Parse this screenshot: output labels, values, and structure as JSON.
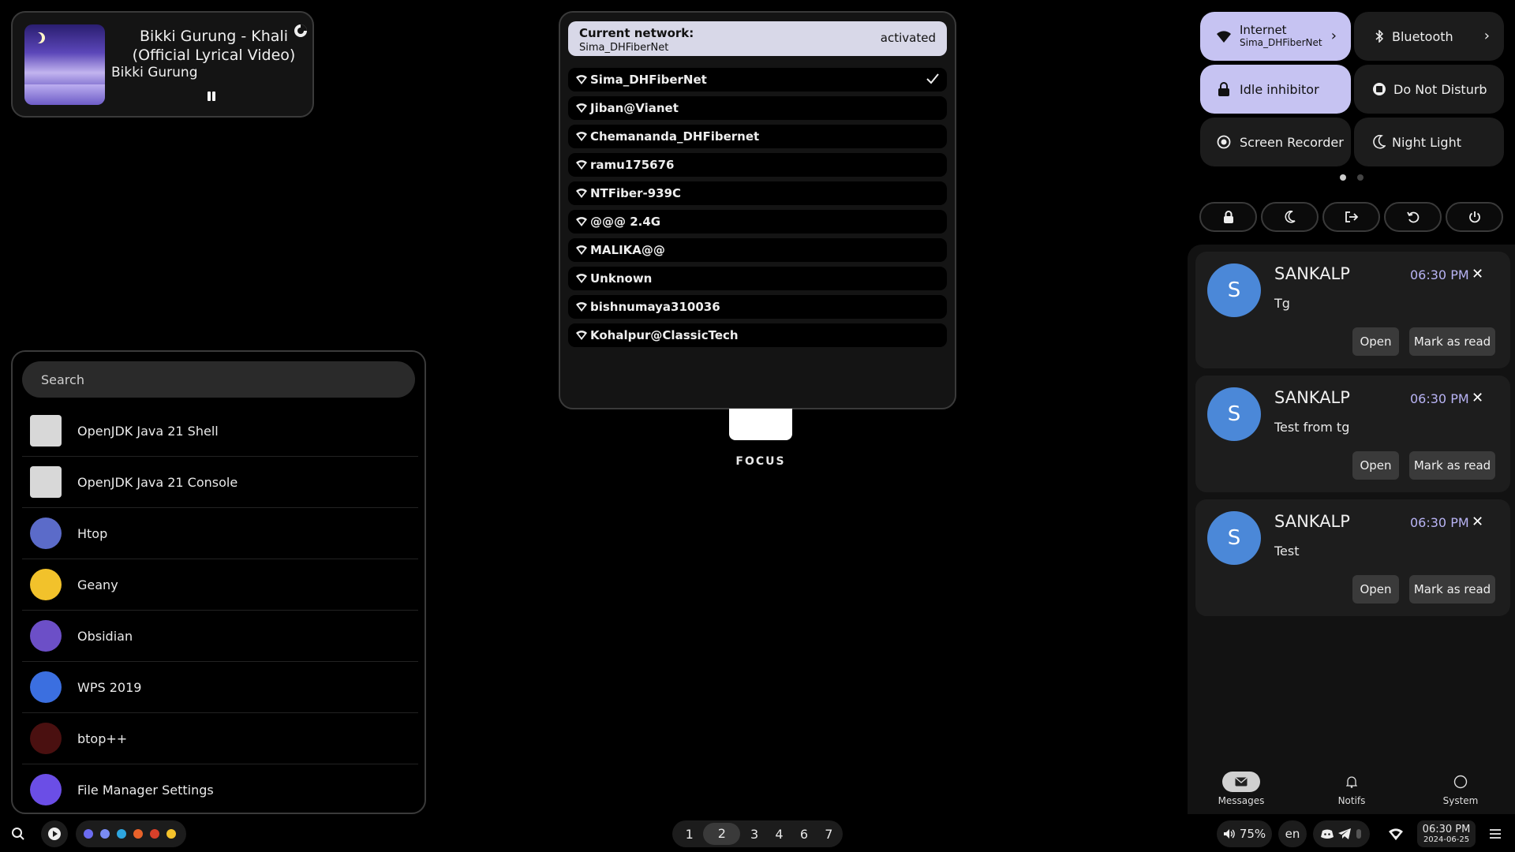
{
  "media": {
    "title": "Bikki Gurung -  Khali (Official Lyrical Video)",
    "artist": "Bikki Gurung",
    "state_icon": "pause-icon"
  },
  "launcher": {
    "search_placeholder": "Search",
    "apps": [
      {
        "name": "OpenJDK Java 21 Shell",
        "icon": "java-icon",
        "color": "#d8d8d8"
      },
      {
        "name": "OpenJDK Java 21 Console",
        "icon": "java-icon",
        "color": "#d8d8d8"
      },
      {
        "name": "Htop",
        "icon": "htop-icon",
        "color": "#5b6bc9"
      },
      {
        "name": "Geany",
        "icon": "geany-icon",
        "color": "#f2c22b"
      },
      {
        "name": "Obsidian",
        "icon": "obsidian-icon",
        "color": "#6c4fc7"
      },
      {
        "name": "WPS 2019",
        "icon": "wps-icon",
        "color": "#3b6fe0"
      },
      {
        "name": "btop++",
        "icon": "btop-icon",
        "color": "#4a1010"
      },
      {
        "name": "File Manager Settings",
        "icon": "folder-icon",
        "color": "#6b4ee6"
      }
    ]
  },
  "network": {
    "current_label": "Current network:",
    "current_ssid": "Sima_DHFiberNet",
    "status": "activated",
    "networks": [
      {
        "ssid": "Sima_DHFiberNet",
        "connected": true
      },
      {
        "ssid": "Jiban@Vianet",
        "connected": false
      },
      {
        "ssid": "Chemananda_DHFibernet",
        "connected": false
      },
      {
        "ssid": "ramu175676",
        "connected": false
      },
      {
        "ssid": "NTFiber-939C",
        "connected": false
      },
      {
        "ssid": "@@@ 2.4G",
        "connected": false
      },
      {
        "ssid": "MALIKA@@",
        "connected": false
      },
      {
        "ssid": "Unknown",
        "connected": false
      },
      {
        "ssid": "bishnumaya310036",
        "connected": false
      },
      {
        "ssid": "Kohalpur@ClassicTech",
        "connected": false
      }
    ]
  },
  "focus": {
    "label": "FOCUS"
  },
  "quick_settings": {
    "internet": {
      "label": "Internet",
      "sub": "Sima_DHFiberNet",
      "on": true
    },
    "bluetooth": {
      "label": "Bluetooth",
      "on": false
    },
    "idle": {
      "label": "Idle inhibitor",
      "on": true
    },
    "dnd": {
      "label": "Do Not Disturb",
      "on": false
    },
    "recorder": {
      "label": "Screen Recorder",
      "on": false
    },
    "night": {
      "label": "Night Light",
      "on": false
    },
    "page_dots": 2,
    "active_page": 1,
    "accent_color": "#c6c3f2"
  },
  "power_buttons": [
    "lock-icon",
    "sleep-icon",
    "logout-icon",
    "restart-icon",
    "power-icon"
  ],
  "notifications": [
    {
      "avatar": "S",
      "from": "SANKALP",
      "time": "06:30 PM",
      "message": "Tg",
      "open": "Open",
      "mark": "Mark as read"
    },
    {
      "avatar": "S",
      "from": "SANKALP",
      "time": "06:30 PM",
      "message": "Test from tg",
      "open": "Open",
      "mark": "Mark as read"
    },
    {
      "avatar": "S",
      "from": "SANKALP",
      "time": "06:30 PM",
      "message": "Test",
      "open": "Open",
      "mark": "Mark as read"
    }
  ],
  "panel_tabs": [
    {
      "label": "Messages",
      "icon": "mail-icon",
      "active": true
    },
    {
      "label": "Notifs",
      "icon": "bell-icon",
      "active": false
    },
    {
      "label": "System",
      "icon": "circle-icon",
      "active": false
    }
  ],
  "taskbar": {
    "workspaces": [
      "1",
      "2",
      "3",
      "4",
      "6",
      "7"
    ],
    "active_workspace": "2",
    "volume": "75%",
    "language": "en",
    "clock_time": "06:30 PM",
    "clock_date": "2024-06-25"
  }
}
